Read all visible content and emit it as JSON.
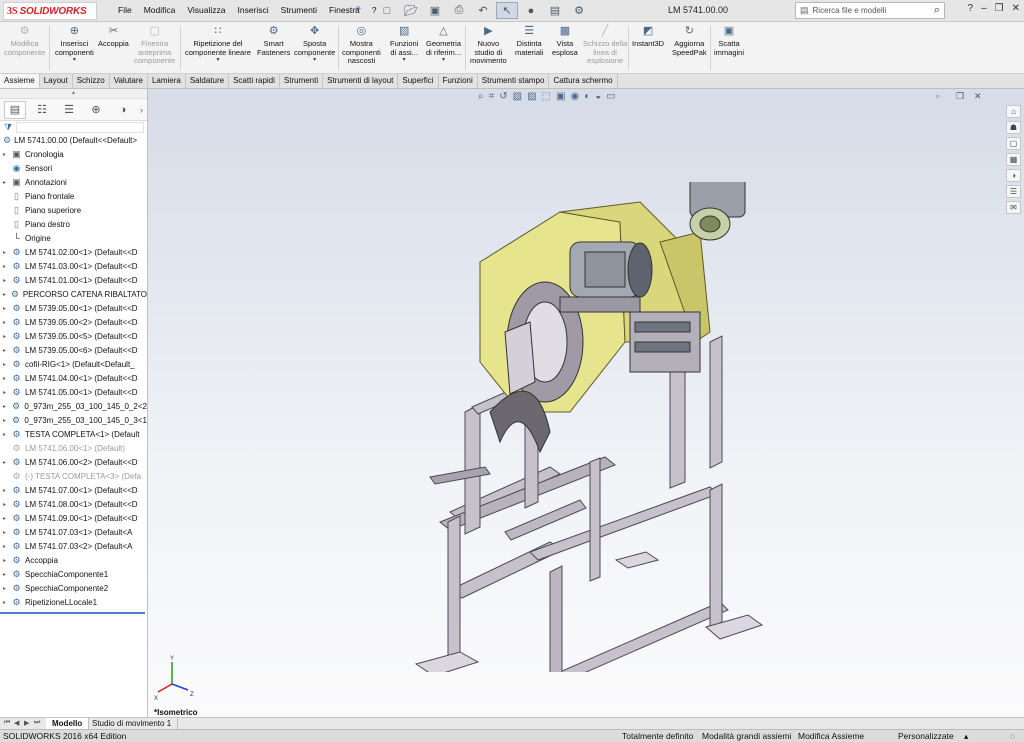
{
  "app": {
    "brand": "SOLIDWORKS",
    "document_title": "LM 5741.00.00"
  },
  "menu": [
    "File",
    "Modifica",
    "Visualizza",
    "Inserisci",
    "Strumenti",
    "Finestra",
    "?"
  ],
  "search": {
    "placeholder": "Ricerca file e modelli"
  },
  "ribbon": [
    {
      "label": "Modifica\ncomponente",
      "disabled": true,
      "icon": "edit-component-icon"
    },
    {
      "label": "Inserisci\ncomponenti",
      "disabled": false,
      "icon": "insert-components-icon",
      "dropdown": true
    },
    {
      "label": "Accoppia",
      "disabled": false,
      "icon": "mate-icon"
    },
    {
      "label": "Finestra\nanteprima\ncomponente",
      "disabled": true,
      "icon": "preview-window-icon"
    },
    {
      "label": "Ripetizione del\ncomponente lineare",
      "disabled": false,
      "icon": "linear-pattern-icon",
      "dropdown": true
    },
    {
      "label": "Smart\nFasteners",
      "disabled": false,
      "icon": "smart-fasteners-icon"
    },
    {
      "label": "Sposta\ncomponente",
      "disabled": false,
      "icon": "move-component-icon",
      "dropdown": true
    },
    {
      "label": "Mostra\ncomponenti\nnascosti",
      "disabled": false,
      "icon": "show-hidden-icon"
    },
    {
      "label": "Funzioni\ndi assi...",
      "disabled": false,
      "icon": "assembly-features-icon",
      "dropdown": true
    },
    {
      "label": "Geometria\ndi riferim...",
      "disabled": false,
      "icon": "reference-geometry-icon",
      "dropdown": true
    },
    {
      "label": "Nuovo\nstudio di\nmovimento",
      "disabled": false,
      "icon": "motion-study-icon"
    },
    {
      "label": "Distinta\nmateriali",
      "disabled": false,
      "icon": "bom-icon"
    },
    {
      "label": "Vista\nesplosa",
      "disabled": false,
      "icon": "exploded-view-icon"
    },
    {
      "label": "Schizzo della\nlinea di\nesplosione",
      "disabled": true,
      "icon": "explode-line-icon"
    },
    {
      "label": "Instant3D",
      "disabled": false,
      "icon": "instant3d-icon"
    },
    {
      "label": "Aggiorna\nSpeedPak",
      "disabled": false,
      "icon": "speedpak-icon"
    },
    {
      "label": "Scatta\nimmagini",
      "disabled": false,
      "icon": "snapshot-icon"
    }
  ],
  "command_tabs": [
    {
      "label": "Assieme",
      "active": true
    },
    {
      "label": "Layout"
    },
    {
      "label": "Schizzo"
    },
    {
      "label": "Valutare"
    },
    {
      "label": "Lamiera"
    },
    {
      "label": "Saldature"
    },
    {
      "label": "Scatti rapidi"
    },
    {
      "label": "Strumenti"
    },
    {
      "label": "Strumenti di layout"
    },
    {
      "label": "Superfici"
    },
    {
      "label": "Funzioni"
    },
    {
      "label": "Strumenti stampo"
    },
    {
      "label": "Cattura schermo"
    }
  ],
  "feature_tree": {
    "root": "LM 5741.00.00  (Default<<Default>",
    "items": [
      {
        "label": "Cronologia",
        "icon": "history-icon",
        "kind": "note",
        "expand": true
      },
      {
        "label": "Sensori",
        "icon": "sensor-icon",
        "kind": "sensor"
      },
      {
        "label": "Annotazioni",
        "icon": "annotation-icon",
        "kind": "note",
        "expand": true
      },
      {
        "label": "Piano frontale",
        "icon": "plane-icon",
        "kind": "plane"
      },
      {
        "label": "Piano superiore",
        "icon": "plane-icon",
        "kind": "plane"
      },
      {
        "label": "Piano destro",
        "icon": "plane-icon",
        "kind": "plane"
      },
      {
        "label": "Origine",
        "icon": "origin-icon",
        "kind": "origin"
      },
      {
        "label": "LM 5741.02.00<1> (Default<<D",
        "icon": "assembly-icon",
        "kind": "asm",
        "expand": true
      },
      {
        "label": "LM 5741.03.00<1> (Default<<D",
        "icon": "assembly-icon",
        "kind": "asm",
        "expand": true
      },
      {
        "label": "LM 5741.01.00<1> (Default<<D",
        "icon": "assembly-icon",
        "kind": "asm",
        "expand": true
      },
      {
        "label": "PERCORSO CATENA RIBALTATO",
        "icon": "assembly-icon",
        "kind": "asm",
        "expand": true
      },
      {
        "label": "LM 5739.05.00<1> (Default<<D",
        "icon": "assembly-icon",
        "kind": "asm",
        "expand": true
      },
      {
        "label": "LM 5739.05.00<2> (Default<<D",
        "icon": "assembly-icon",
        "kind": "asm",
        "expand": true
      },
      {
        "label": "LM 5739.05.00<5> (Default<<D",
        "icon": "assembly-icon",
        "kind": "asm",
        "expand": true
      },
      {
        "label": "LM 5739.05.00<6> (Default<<D",
        "icon": "assembly-icon",
        "kind": "asm",
        "expand": true
      },
      {
        "label": "cofil-RIG<1> (Default<Default_",
        "icon": "assembly-icon",
        "kind": "asm",
        "expand": true
      },
      {
        "label": "LM 5741.04.00<1> (Default<<D",
        "icon": "assembly-icon",
        "kind": "asm",
        "expand": true
      },
      {
        "label": "LM 5741.05.00<1> (Default<<D",
        "icon": "assembly-icon",
        "kind": "asm",
        "expand": true
      },
      {
        "label": "0_973m_255_03_100_145_0_2<2",
        "icon": "assembly-icon",
        "kind": "asm",
        "expand": true
      },
      {
        "label": "0_973m_255_03_100_145_0_3<1",
        "icon": "assembly-icon",
        "kind": "asm",
        "expand": true
      },
      {
        "label": "TESTA COMPLETA<1> (Default",
        "icon": "assembly-icon",
        "kind": "asm",
        "expand": true
      },
      {
        "label": "LM 5741.06.00<1> (Default)",
        "icon": "assembly-icon",
        "kind": "asm",
        "muted": true
      },
      {
        "label": "LM 5741.06.00<2> (Default<<D",
        "icon": "assembly-icon",
        "kind": "asm",
        "expand": true
      },
      {
        "label": "(-) TESTA COMPLETA<3> (Defa",
        "icon": "assembly-icon",
        "kind": "asm",
        "muted": true
      },
      {
        "label": "LM 5741.07.00<1> (Default<<D",
        "icon": "assembly-icon",
        "kind": "asm",
        "expand": true
      },
      {
        "label": "LM 5741.08.00<1> (Default<<D",
        "icon": "assembly-icon",
        "kind": "asm",
        "expand": true
      },
      {
        "label": "LM 5741.09.00<1> (Default<<D",
        "icon": "assembly-icon",
        "kind": "asm",
        "expand": true
      },
      {
        "label": "LM 5741.07.03<1> (Default<A",
        "icon": "assembly-icon",
        "kind": "asm",
        "expand": true
      },
      {
        "label": "LM 5741.07.03<2> (Default<A",
        "icon": "assembly-icon",
        "kind": "asm",
        "expand": true
      },
      {
        "label": "Accoppia",
        "icon": "mates-icon",
        "kind": "asm",
        "expand": true
      },
      {
        "label": "SpecchiaComponente1",
        "icon": "mirror-icon",
        "kind": "asm",
        "expand": true
      },
      {
        "label": "SpecchiaComponente2",
        "icon": "mirror-icon",
        "kind": "asm",
        "expand": true
      },
      {
        "label": "RipetizioneLLocale1",
        "icon": "pattern-icon",
        "kind": "asm",
        "expand": true
      }
    ]
  },
  "viewport": {
    "view_name": "*Isometrico"
  },
  "bottom_tabs": [
    {
      "label": "Modello",
      "active": true
    },
    {
      "label": "Studio di movimento 1"
    }
  ],
  "status": {
    "edition": "SOLIDWORKS 2016 x64 Edition",
    "definition": "Totalmente definito",
    "large_assembly": "Modalità grandi assiemi",
    "mode": "Modifica Assieme",
    "custom": "Personalizzate"
  }
}
